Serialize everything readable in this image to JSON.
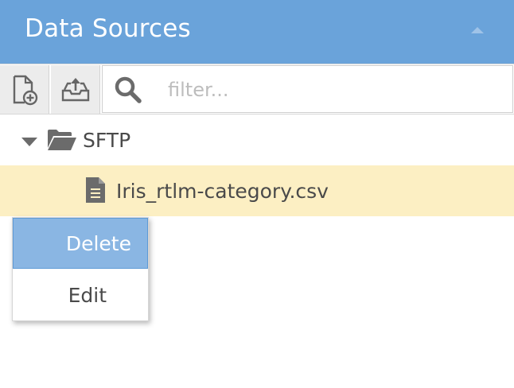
{
  "panel": {
    "title": "Data Sources",
    "collapse_icon": "caret-up-icon"
  },
  "toolbar": {
    "add_source_icon": "add-file-icon",
    "import_icon": "inbox-upload-icon",
    "search_icon": "search-icon",
    "filter_placeholder": "filter...",
    "filter_value": ""
  },
  "tree": {
    "folder": {
      "label": "SFTP",
      "expanded": true,
      "icon": "folder-open-icon"
    },
    "files": [
      {
        "label": "Iris_rtlm-category.csv",
        "icon": "file-text-icon",
        "selected": true
      }
    ]
  },
  "context_menu": {
    "items": [
      {
        "label": "Delete",
        "active": true
      },
      {
        "label": "Edit",
        "active": false
      }
    ]
  },
  "colors": {
    "header_bg": "#6aa3da",
    "selected_row_bg": "#fcefc3",
    "menu_active_bg": "#8ab6e3"
  }
}
